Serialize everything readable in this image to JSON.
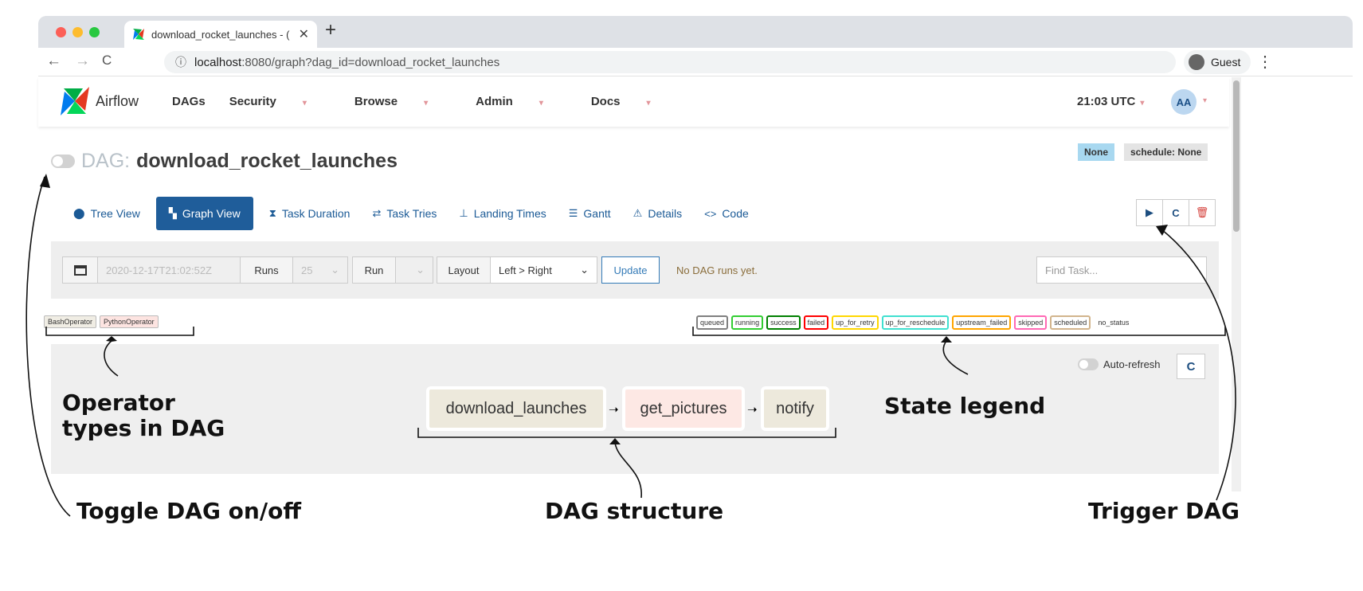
{
  "browser": {
    "tab_title": "download_rocket_launches - (",
    "url_host": "localhost",
    "url_rest": ":8080/graph?dag_id=download_rocket_launches",
    "guest_label": "Guest",
    "colors": {
      "red": "#fc5f57",
      "yellow": "#fdbc2e",
      "green": "#28c840"
    }
  },
  "navbar": {
    "brand": "Airflow",
    "menu": [
      "DAGs",
      "Security",
      "Browse",
      "Admin",
      "Docs"
    ],
    "time": "21:03 UTC",
    "user_initials": "AA"
  },
  "dag": {
    "label": "DAG:",
    "name": "download_rocket_launches",
    "badge_none": "None",
    "badge_schedule": "schedule: None"
  },
  "views": {
    "tree": "Tree View",
    "graph": "Graph View",
    "duration": "Task Duration",
    "tries": "Task Tries",
    "landing": "Landing Times",
    "gantt": "Gantt",
    "details": "Details",
    "code": "Code"
  },
  "filters": {
    "date": "2020-12-17T21:02:52Z",
    "runs_label": "Runs",
    "runs_value": "25",
    "run_label": "Run",
    "layout_label": "Layout",
    "layout_value": "Left > Right",
    "update": "Update",
    "no_runs": "No DAG runs yet.",
    "find_placeholder": "Find Task..."
  },
  "operators": [
    "BashOperator",
    "PythonOperator"
  ],
  "states": [
    {
      "label": "queued",
      "color": "#808080"
    },
    {
      "label": "running",
      "color": "#32cd32"
    },
    {
      "label": "success",
      "color": "#008000"
    },
    {
      "label": "failed",
      "color": "#ff0000"
    },
    {
      "label": "up_for_retry",
      "color": "#ffd700"
    },
    {
      "label": "up_for_reschedule",
      "color": "#40e0d0"
    },
    {
      "label": "upstream_failed",
      "color": "#ffa500"
    },
    {
      "label": "skipped",
      "color": "#ff69b4"
    },
    {
      "label": "scheduled",
      "color": "#d2b48c"
    },
    {
      "label": "no_status",
      "color": "#ffffff"
    }
  ],
  "graph": {
    "auto_refresh": "Auto-refresh",
    "tasks": [
      "download_launches",
      "get_pictures",
      "notify"
    ]
  },
  "annotations": {
    "operators_line1": "Operator",
    "operators_line2": "types in DAG",
    "state_legend": "State legend",
    "toggle": "Toggle DAG on/off",
    "structure": "DAG structure",
    "trigger": "Trigger DAG"
  }
}
